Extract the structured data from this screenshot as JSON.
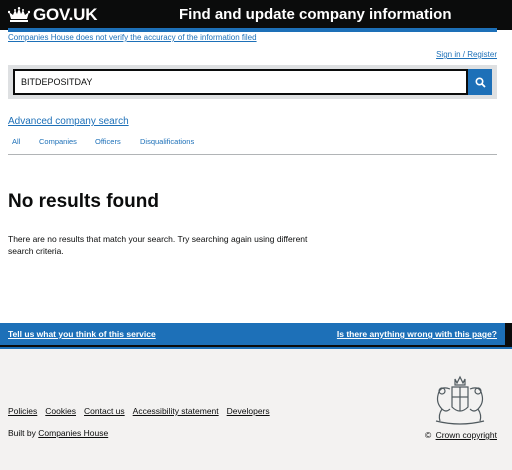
{
  "header": {
    "logo_text": "GOV.UK",
    "service_title": "Find and update company information"
  },
  "disclaimer": "Companies House does not verify the accuracy of the information filed",
  "signin": "Sign in / Register",
  "search": {
    "value": "BITDEPOSITDAY",
    "button_icon": "search-icon"
  },
  "advanced_search": "Advanced company search",
  "tabs": [
    {
      "label": "All",
      "active": true
    },
    {
      "label": "Companies",
      "active": false
    },
    {
      "label": "Officers",
      "active": false
    },
    {
      "label": "Disqualifications",
      "active": false
    }
  ],
  "results": {
    "heading": "No results found",
    "message": "There are no results that match your search. Try searching again using different search criteria."
  },
  "feedback": {
    "left": "Tell us what you think of this service",
    "right": "Is there anything wrong with this page?"
  },
  "footer": {
    "links": [
      "Policies",
      "Cookies",
      "Contact us",
      "Accessibility statement",
      "Developers"
    ],
    "built_by_prefix": "Built by",
    "built_by_link": "Companies House",
    "copyright_symbol": "©",
    "copyright": "Crown copyright"
  },
  "colors": {
    "brand_blue": "#1d70b8",
    "header_black": "#0b0c0c",
    "footer_bg": "#f3f2f1"
  }
}
